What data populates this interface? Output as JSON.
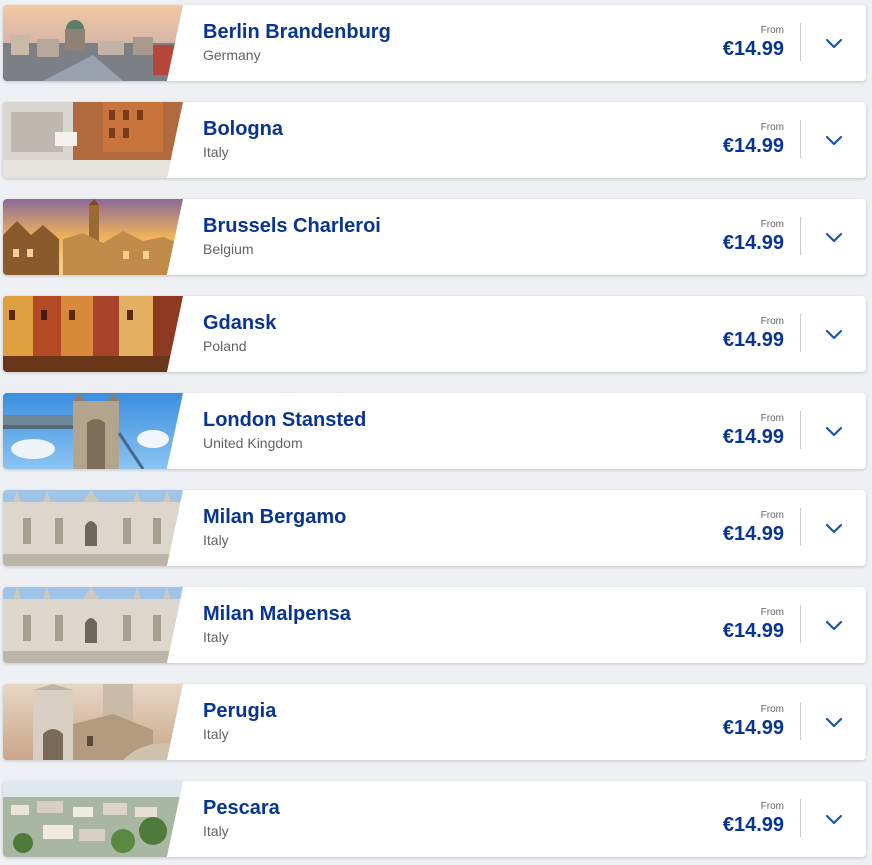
{
  "destinations": [
    {
      "city": "Berlin Brandenburg",
      "country": "Germany",
      "from_label": "From",
      "price": "€14.99",
      "image": "berlin-cityscape"
    },
    {
      "city": "Bologna",
      "country": "Italy",
      "from_label": "From",
      "price": "€14.99",
      "image": "bologna-rooftops"
    },
    {
      "city": "Brussels Charleroi",
      "country": "Belgium",
      "from_label": "From",
      "price": "€14.99",
      "image": "brussels-grand-place"
    },
    {
      "city": "Gdansk",
      "country": "Poland",
      "from_label": "From",
      "price": "€14.99",
      "image": "gdansk-old-town"
    },
    {
      "city": "London Stansted",
      "country": "United Kingdom",
      "from_label": "From",
      "price": "€14.99",
      "image": "tower-bridge"
    },
    {
      "city": "Milan Bergamo",
      "country": "Italy",
      "from_label": "From",
      "price": "€14.99",
      "image": "milan-cathedral"
    },
    {
      "city": "Milan Malpensa",
      "country": "Italy",
      "from_label": "From",
      "price": "€14.99",
      "image": "milan-cathedral"
    },
    {
      "city": "Perugia",
      "country": "Italy",
      "from_label": "From",
      "price": "€14.99",
      "image": "perugia-church"
    },
    {
      "city": "Pescara",
      "country": "Italy",
      "from_label": "From",
      "price": "€14.99",
      "image": "pescara-town"
    }
  ],
  "colors": {
    "title": "#073590",
    "subtitle": "#5f6368",
    "chevron": "#1a56b0",
    "background": "#eef0f3"
  },
  "icons": {
    "expand": "chevron-down-icon"
  }
}
